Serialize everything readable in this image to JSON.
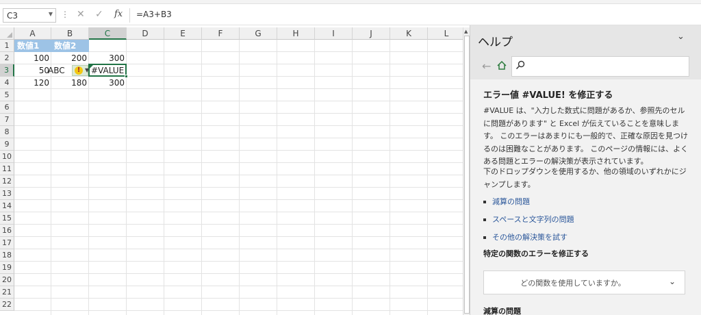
{
  "formula_bar": {
    "name_box": "C3",
    "formula": "=A3+B3"
  },
  "columns": [
    "A",
    "B",
    "C",
    "D",
    "E",
    "F",
    "G",
    "H",
    "I",
    "J",
    "K",
    "L"
  ],
  "rows": [
    "1",
    "2",
    "3",
    "4",
    "5",
    "6",
    "7",
    "8",
    "9",
    "10",
    "11",
    "12",
    "13",
    "14",
    "15",
    "16",
    "17",
    "18",
    "19",
    "20",
    "21",
    "22"
  ],
  "active_cell": "C3",
  "cells": {
    "A1": "数値1",
    "B1": "数値2",
    "A2": "100",
    "B2": "200",
    "C2": "300",
    "A3": "50",
    "B3": "ABC",
    "C3": "#VALUE!",
    "A4": "120",
    "B4": "180",
    "C4": "300"
  },
  "colors": {
    "header_fill": "#9dc3e6",
    "accent_green": "#217346"
  },
  "help": {
    "pane_title": "ヘルプ",
    "article_title": "エラー値 #VALUE! を修正する",
    "para_1": "#VALUE は、\"入力した数式に問題があるか、参照先のセルに問題があります\" と Excel が伝えていることを意味します。 このエラーはあまりにも一般的で、正確な原因を見つけるのは困難なことがあります。 このページの情報には、よくある問題とエラーの解決策が表示されています。",
    "para_2": "下のドロップダウンを使用するか、他の領域のいずれかにジャンプします。",
    "links": [
      "減算の問題",
      "スペースと文字列の問題",
      "その他の解決策を試す"
    ],
    "section_1": "特定の関数のエラーを修正する",
    "dropdown_placeholder": "どの関数を使用していますか。",
    "section_2": "減算の問題"
  },
  "icons": {
    "name_box_arrow": "chevron-down-icon",
    "cancel": "close-icon",
    "enter": "checkmark-icon",
    "fx": "function-icon",
    "back": "arrow-left-icon",
    "home": "home-icon",
    "search": "search-icon",
    "collapse": "chevron-down-icon",
    "warning": "warning-icon"
  }
}
